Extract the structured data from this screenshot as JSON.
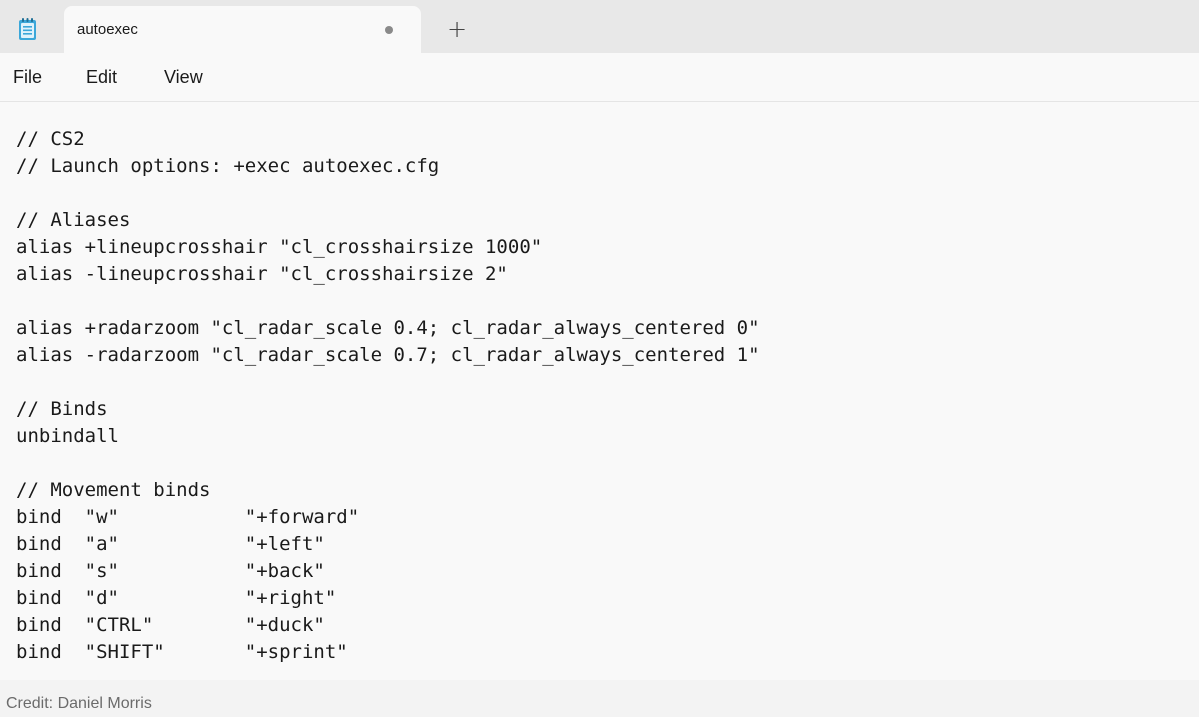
{
  "app": {
    "icon": "notepad-icon"
  },
  "tabs": [
    {
      "title": "autoexec",
      "unsaved_indicator": "dot-icon"
    }
  ],
  "new_tab": {
    "label": "+"
  },
  "menu": {
    "file": "File",
    "edit": "Edit",
    "view": "View"
  },
  "editor": {
    "lines": [
      "// CS2",
      "// Launch options: +exec autoexec.cfg",
      "",
      "// Aliases",
      "alias +lineupcrosshair \"cl_crosshairsize 1000\"",
      "alias -lineupcrosshair \"cl_crosshairsize 2\"",
      "",
      "alias +radarzoom \"cl_radar_scale 0.4; cl_radar_always_centered 0\"",
      "alias -radarzoom \"cl_radar_scale 0.7; cl_radar_always_centered 1\"",
      "",
      "// Binds",
      "unbindall",
      "",
      "// Movement binds",
      "bind  \"w\"           \"+forward\"",
      "bind  \"a\"           \"+left\"",
      "bind  \"s\"           \"+back\"",
      "bind  \"d\"           \"+right\"",
      "bind  \"CTRL\"        \"+duck\"",
      "bind  \"SHIFT\"       \"+sprint\""
    ]
  },
  "credit": "Credit: Daniel Morris",
  "colors": {
    "tabbar_bg": "#e8e8e8",
    "editor_bg": "#f9f9f9",
    "text": "#1a1a1a",
    "credit_text": "#6b6b6b"
  }
}
